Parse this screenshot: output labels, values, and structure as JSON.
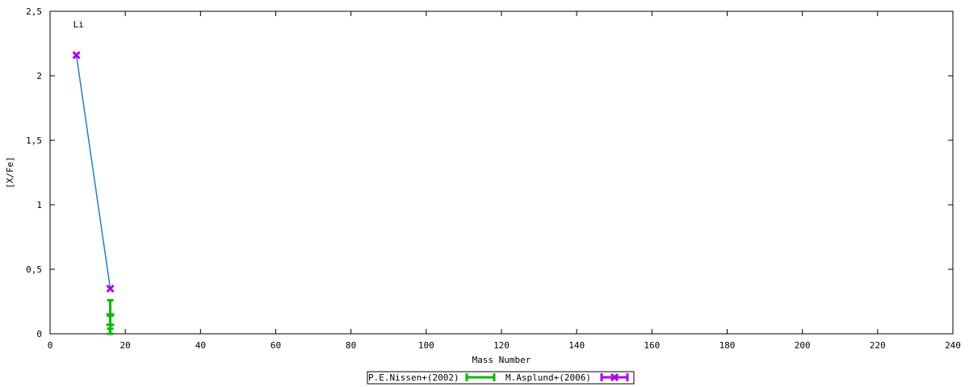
{
  "chart_data": {
    "type": "scatter",
    "xlabel": "Mass Number",
    "ylabel": "[X/Fe]",
    "xlim": [
      0,
      240
    ],
    "ylim": [
      0,
      2.5
    ],
    "x_ticks": [
      0,
      20,
      40,
      60,
      80,
      100,
      120,
      140,
      160,
      180,
      200,
      220,
      240
    ],
    "y_ticks": [
      0,
      0.5,
      1,
      1.5,
      2,
      2.5
    ],
    "y_tick_labels": [
      "0",
      "0,5",
      "1",
      "1,5",
      "2",
      "2,5"
    ],
    "grid": false,
    "legend_position": "bottom",
    "annotations": [
      {
        "text": "Li",
        "x": 7,
        "y": 2.4
      }
    ],
    "line": {
      "color": "#1e7fd6",
      "points": [
        {
          "x": 7,
          "y": 2.16
        },
        {
          "x": 16,
          "y": 0.35
        }
      ]
    },
    "series": [
      {
        "name": "P.E.Nissen+(2002)",
        "color": "#00bb00",
        "points": [
          {
            "x": 16,
            "y": 0.15,
            "err_low": 0.11,
            "err_high": 0.11
          },
          {
            "x": 16,
            "y": 0.07,
            "err_low": 0.07,
            "err_high": 0.07
          }
        ]
      },
      {
        "name": "M.Asplund+(2006)",
        "color": "#b000e8",
        "points": [
          {
            "x": 7,
            "y": 2.16,
            "err_low": 0.0,
            "err_high": 0.0
          },
          {
            "x": 16,
            "y": 0.35,
            "err_low": 0.0,
            "err_high": 0.0
          }
        ]
      }
    ]
  }
}
